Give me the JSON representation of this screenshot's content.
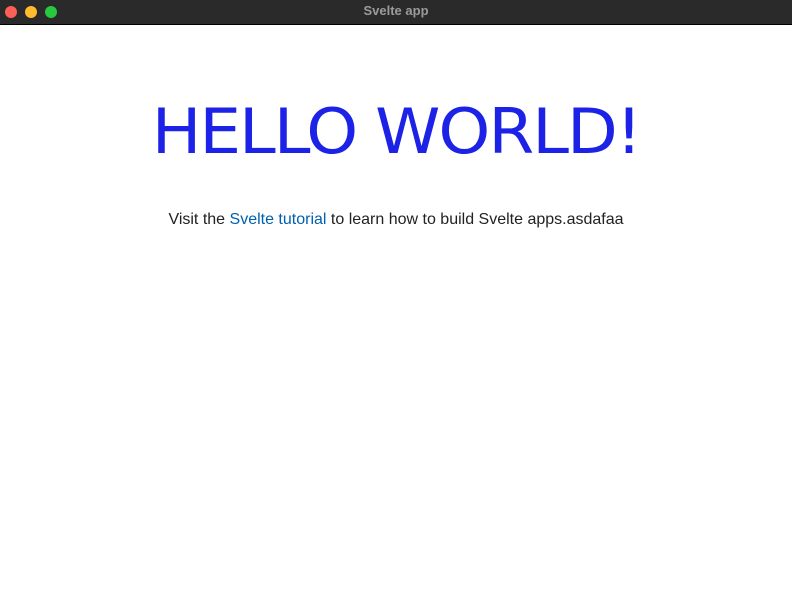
{
  "window": {
    "title": "Svelte app"
  },
  "main": {
    "heading": "HELLO WORLD!",
    "paragraph_before": "Visit the ",
    "link_text": "Svelte tutorial",
    "paragraph_after": " to learn how to build Svelte apps.asdafaa"
  },
  "colors": {
    "heading": "#1c22e6",
    "link": "#0060b0",
    "titlebar": "#2a2a2a",
    "close": "#fe5f57",
    "minimize": "#febc2e",
    "zoom": "#28c840"
  }
}
